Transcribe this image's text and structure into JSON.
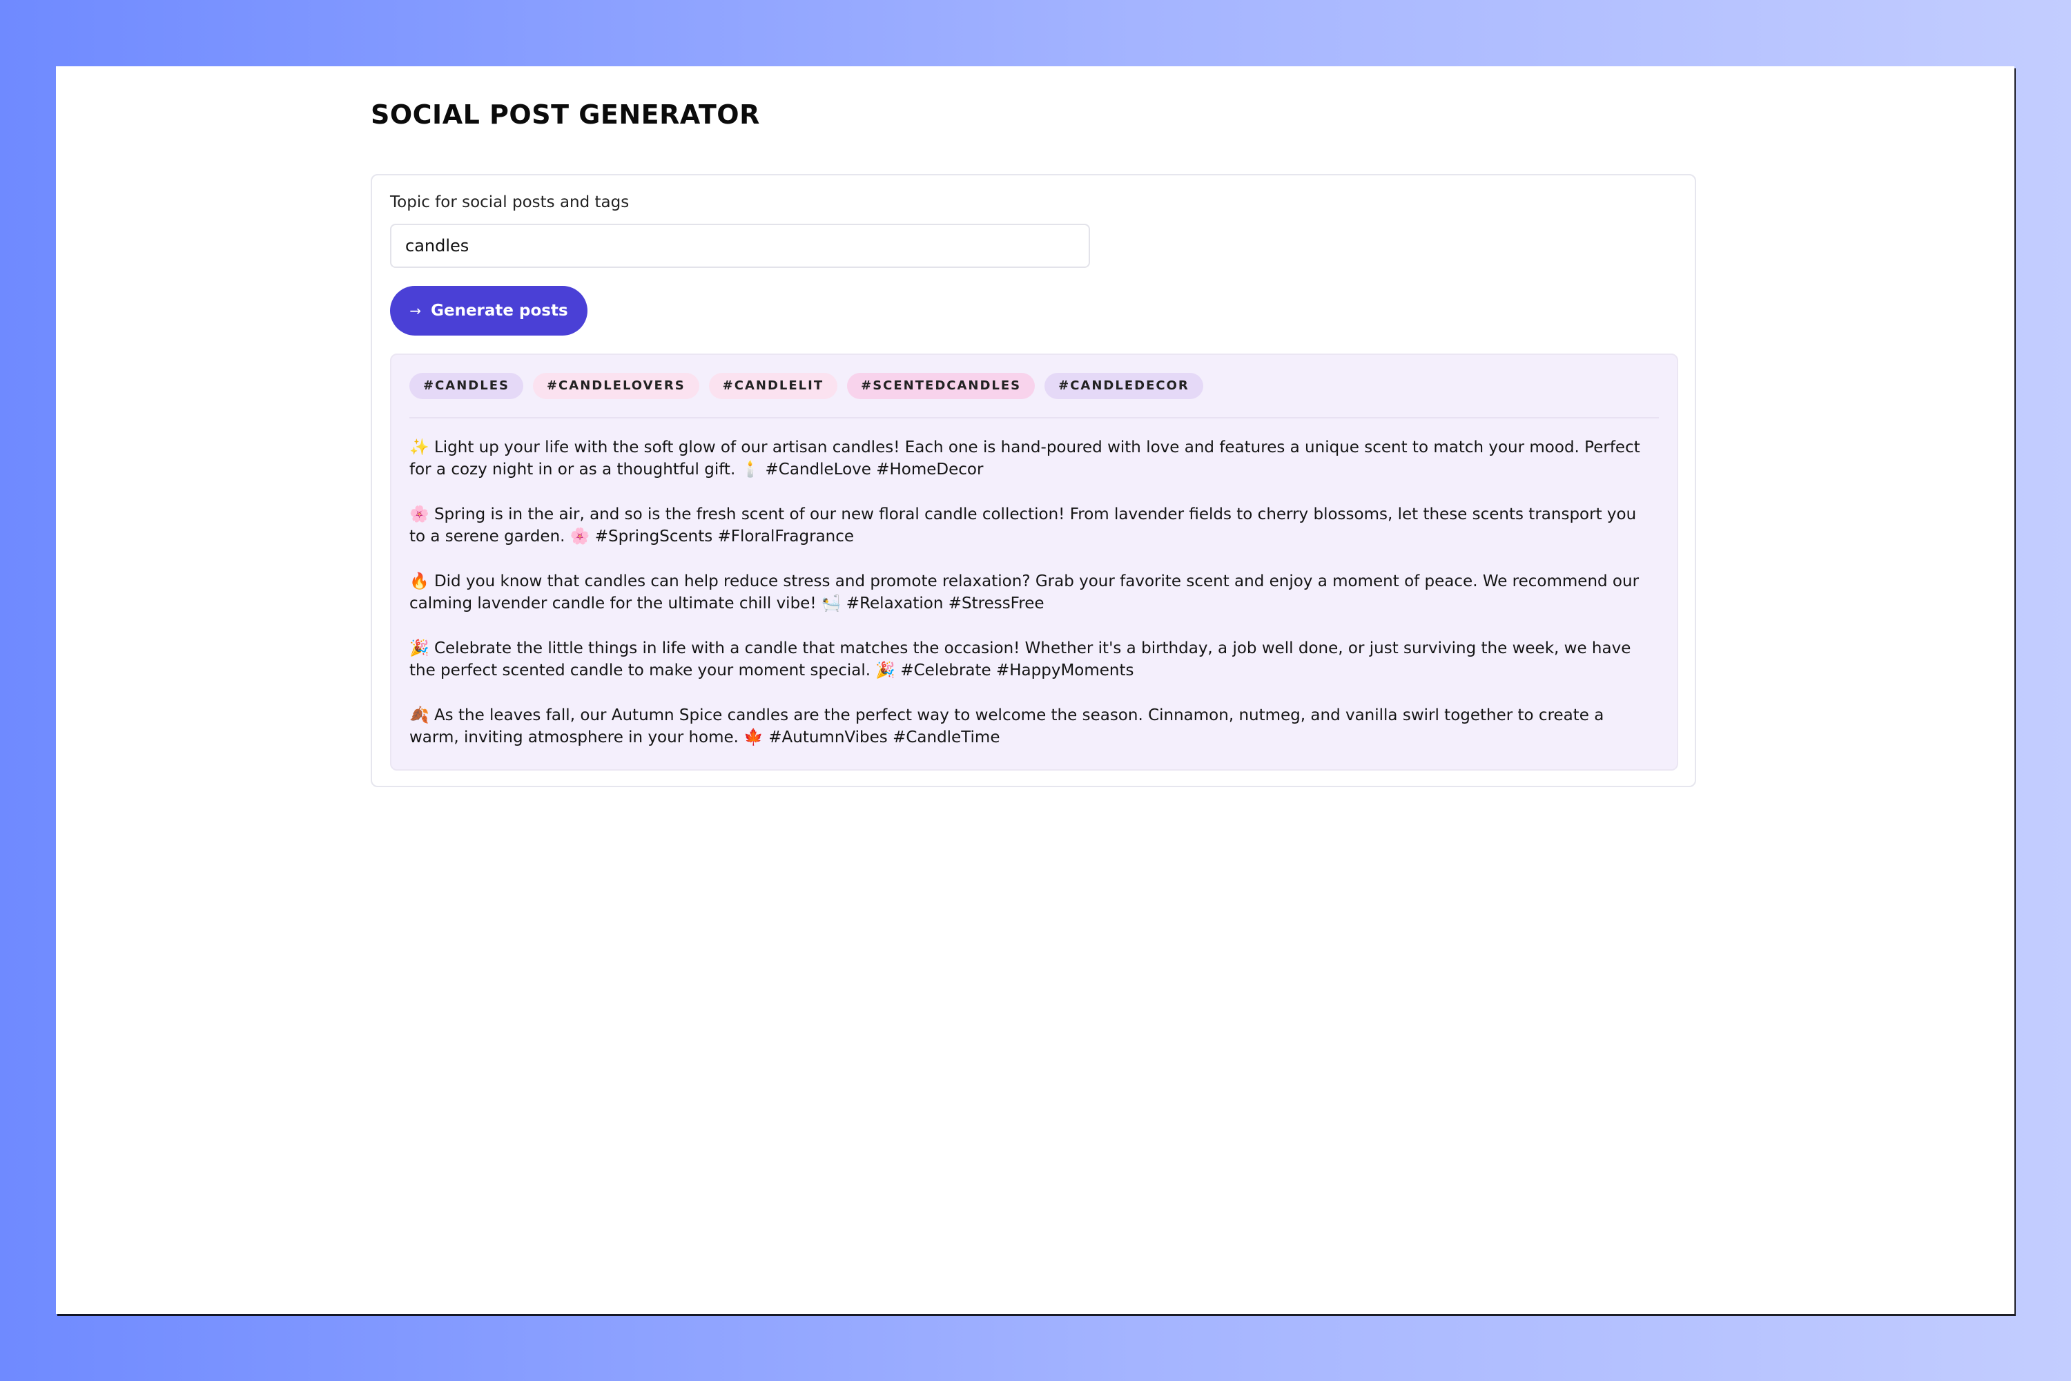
{
  "app": {
    "title": "SOCIAL POST GENERATOR"
  },
  "form": {
    "topic_label": "Topic for social posts and tags",
    "topic_value": "candles",
    "generate_label": "Generate posts",
    "generate_icon": "arrow-right-icon"
  },
  "results": {
    "tags": [
      {
        "label": "#CANDLES",
        "color": "#e5d9f7"
      },
      {
        "label": "#CANDLELOVERS",
        "color": "#fbe2f0"
      },
      {
        "label": "#CANDLELIT",
        "color": "#fbe2f0"
      },
      {
        "label": "#SCENTEDCANDLES",
        "color": "#f8d3ec"
      },
      {
        "label": "#CANDLEDECOR",
        "color": "#e5d9f7"
      }
    ],
    "posts": [
      "✨ Light up your life with the soft glow of our artisan candles! Each one is hand-poured with love and features a unique scent to match your mood. Perfect for a cozy night in or as a thoughtful gift. 🕯️ #CandleLove #HomeDecor",
      "🌸 Spring is in the air, and so is the fresh scent of our new floral candle collection! From lavender fields to cherry blossoms, let these scents transport you to a serene garden. 🌸 #SpringScents #FloralFragrance",
      "🔥 Did you know that candles can help reduce stress and promote relaxation? Grab your favorite scent and enjoy a moment of peace. We recommend our calming lavender candle for the ultimate chill vibe! 🛀 #Relaxation #StressFree",
      "🎉 Celebrate the little things in life with a candle that matches the occasion! Whether it's a birthday, a job well done, or just surviving the week, we have the perfect scented candle to make your moment special. 🎉 #Celebrate #HappyMoments",
      "🍂 As the leaves fall, our Autumn Spice candles are the perfect way to welcome the season. Cinnamon, nutmeg, and vanilla swirl together to create a warm, inviting atmosphere in your home. 🍁 #AutumnVibes #CandleTime"
    ]
  },
  "colors": {
    "accent": "#4a40d6",
    "results_bg": "#f4effc"
  }
}
